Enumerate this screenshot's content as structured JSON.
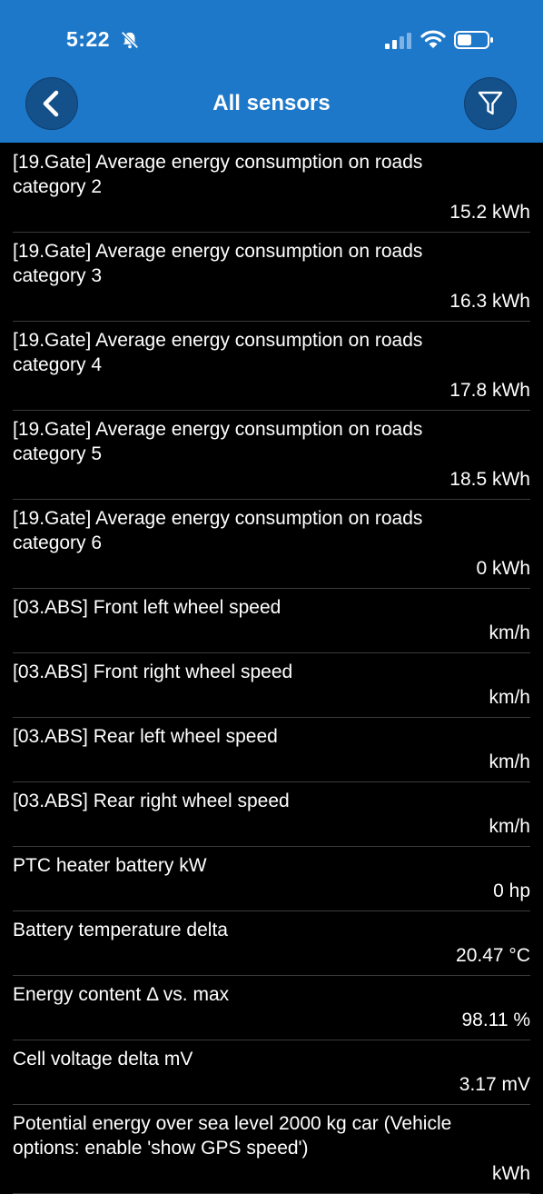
{
  "status_bar": {
    "time": "5:22"
  },
  "header": {
    "title": "All sensors"
  },
  "sensors": [
    {
      "label": "[19.Gate] Average energy consumption on roads category 2",
      "value": "15.2 kWh"
    },
    {
      "label": "[19.Gate] Average energy consumption on roads category 3",
      "value": "16.3 kWh"
    },
    {
      "label": "[19.Gate] Average energy consumption on roads category 4",
      "value": "17.8 kWh"
    },
    {
      "label": "[19.Gate] Average energy consumption on roads category 5",
      "value": "18.5 kWh"
    },
    {
      "label": "[19.Gate] Average energy consumption on roads category 6",
      "value": "0 kWh"
    },
    {
      "label": "[03.ABS] Front left wheel speed",
      "value": "km/h"
    },
    {
      "label": "[03.ABS] Front right wheel speed",
      "value": "km/h"
    },
    {
      "label": "[03.ABS] Rear left wheel speed",
      "value": "km/h"
    },
    {
      "label": "[03.ABS] Rear right wheel speed",
      "value": "km/h"
    },
    {
      "label": "PTC heater battery kW",
      "value": "0 hp"
    },
    {
      "label": "Battery temperature delta",
      "value": "20.47 °C"
    },
    {
      "label": "Energy content Δ vs. max",
      "value": "98.11 %"
    },
    {
      "label": "Cell voltage delta mV",
      "value": "3.17 mV"
    },
    {
      "label": "Potential energy over sea level 2000 kg car (Vehicle options: enable 'show GPS speed')",
      "value": "kWh"
    }
  ],
  "colors": {
    "header_bg": "#1d78c9",
    "button_bg": "#14508a",
    "background": "#000000",
    "divider": "#3a3a3c",
    "text": "#ffffff"
  },
  "icons": {
    "back": "chevron-left-icon",
    "filter": "filter-funnel-icon",
    "silent": "bell-slash-icon",
    "signal": "cellular-signal-icon",
    "wifi": "wifi-icon",
    "battery": "battery-icon"
  }
}
